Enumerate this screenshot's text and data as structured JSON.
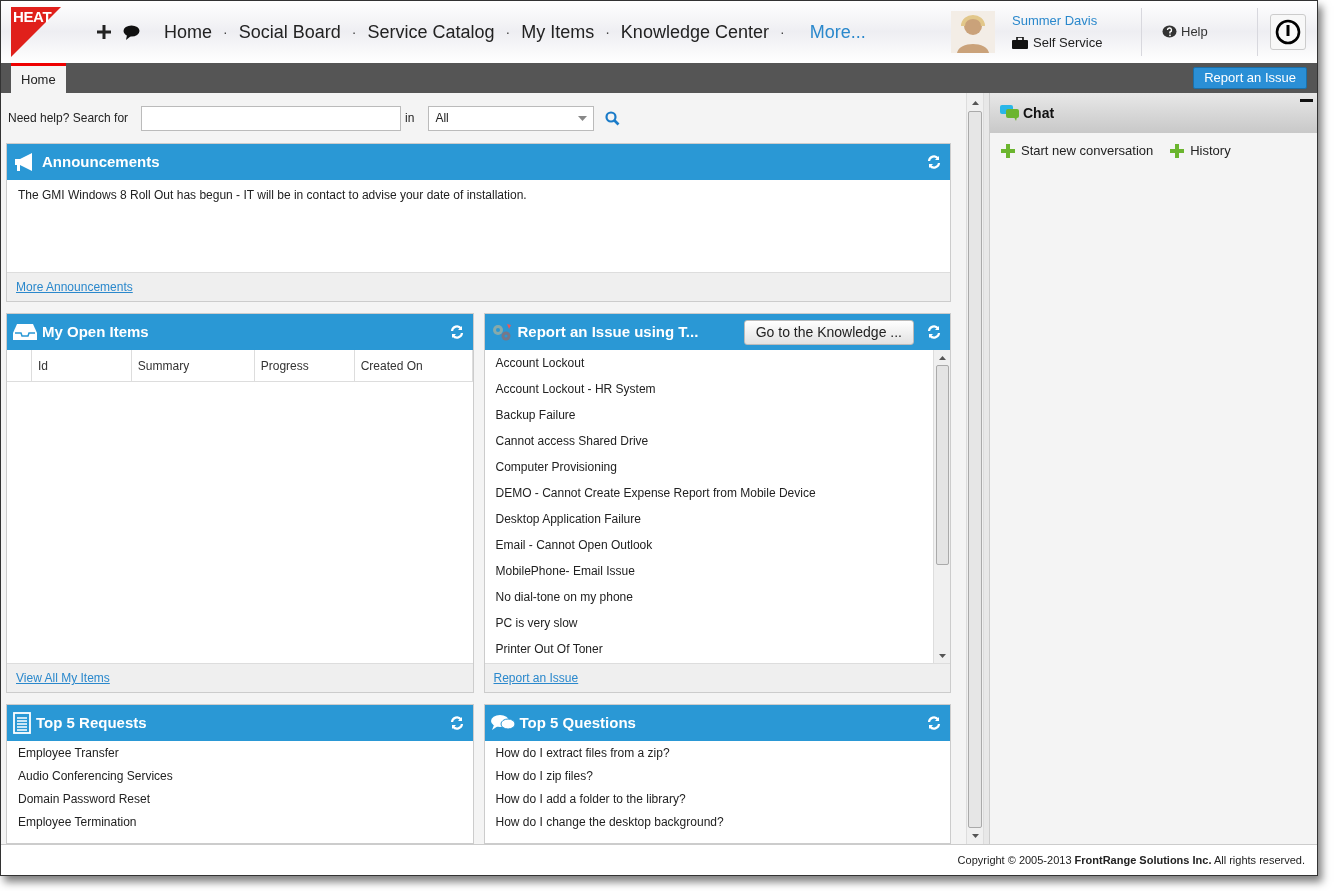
{
  "header": {
    "logo": "HEAT",
    "nav": [
      {
        "label": "Home"
      },
      {
        "label": "Social Board"
      },
      {
        "label": "Service Catalog"
      },
      {
        "label": "My Items"
      },
      {
        "label": "Knowledge Center"
      }
    ],
    "separator": "·",
    "more": "More...",
    "user": {
      "name": "Summer Davis",
      "role": "Self Service"
    },
    "help": "Help"
  },
  "tabs": [
    {
      "label": "Home",
      "selected": true
    }
  ],
  "report_button": "Report an Issue",
  "search": {
    "label": "Need help? Search for",
    "in_label": "in",
    "scope": "All"
  },
  "panels": [
    {
      "kind": "text",
      "title": "Announcements",
      "text": "The GMI Windows 8 Roll Out has begun - IT will be in contact to advise your date of installation.",
      "footer_link": "More Announcements"
    },
    {
      "kind": "table",
      "title": "My Open Items",
      "columns": [
        "Id",
        "Summary",
        "Progress",
        "Created On"
      ],
      "footer_link": "View All My Items"
    },
    {
      "kind": "list",
      "title": "Report an Issue using T...",
      "header_button": "Go to the Knowledge ...",
      "scrollable": true,
      "items": [
        "Account Lockout",
        "Account Lockout - HR System",
        "Backup Failure",
        "Cannot access Shared Drive",
        "Computer Provisioning",
        "DEMO - Cannot Create Expense Report from Mobile Device",
        "Desktop Application Failure",
        "Email - Cannot Open Outlook",
        "MobilePhone- Email Issue",
        "No dial-tone on my phone",
        "PC is very slow",
        "Printer Out Of Toner"
      ],
      "footer_link": "Report an Issue"
    },
    {
      "kind": "list",
      "title": "Top 5 Requests",
      "items": [
        "Employee Transfer",
        "Audio Conferencing Services",
        "Domain Password Reset",
        "Employee Termination"
      ]
    },
    {
      "kind": "list",
      "title": "Top 5 Questions",
      "items": [
        "How do I extract files from a zip?",
        "How do I zip files?",
        "How do I add a folder to the library?",
        "How do I change the desktop background?"
      ]
    }
  ],
  "chat": {
    "title": "Chat",
    "actions": [
      "Start new conversation",
      "History"
    ]
  },
  "footer": "Copyright © 2005-2013 **FrontRange Solutions Inc.** All rights reserved."
}
